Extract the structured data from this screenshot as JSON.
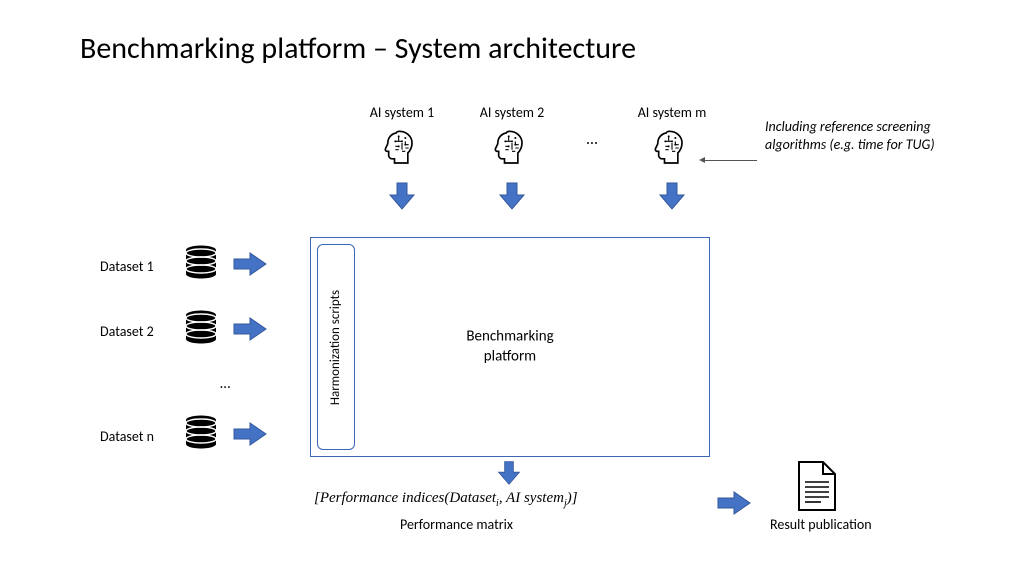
{
  "title": "Benchmarking platform – System architecture",
  "ai_systems": [
    "AI system 1",
    "AI system 2",
    "AI system m"
  ],
  "ellipsis": "…",
  "annotation": "Including reference screening algorithms (e.g. time for TUG)",
  "datasets": [
    "Dataset 1",
    "Dataset 2",
    "Dataset n"
  ],
  "harmonization_label": "Harmonization scripts",
  "platform_label_1": "Benchmarking",
  "platform_label_2": "platform",
  "performance_formula_prefix": "[Performance indices(Dataset",
  "performance_formula_sub1": "i",
  "performance_formula_mid": ", AI system",
  "performance_formula_sub2": "j",
  "performance_formula_suffix": ")]",
  "performance_label": "Performance matrix",
  "result_label": "Result publication"
}
